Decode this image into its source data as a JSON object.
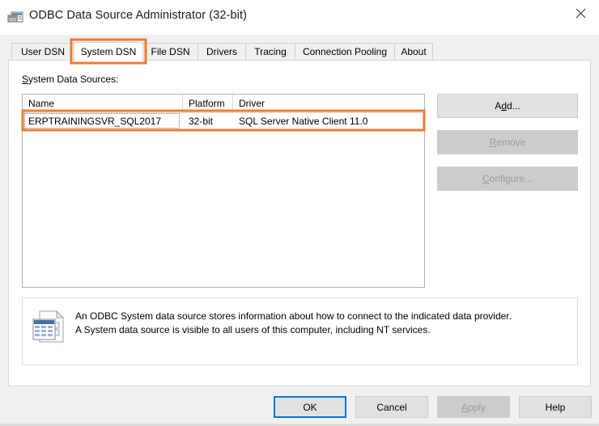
{
  "window": {
    "title": "ODBC Data Source Administrator (32-bit)",
    "icon": "odbc-administrator-icon",
    "close_label": "✕"
  },
  "tabs": [
    {
      "label": "User DSN",
      "selected": false
    },
    {
      "label": "System DSN",
      "selected": true
    },
    {
      "label": "File DSN",
      "selected": false
    },
    {
      "label": "Drivers",
      "selected": false
    },
    {
      "label": "Tracing",
      "selected": false
    },
    {
      "label": "Connection Pooling",
      "selected": false
    },
    {
      "label": "About",
      "selected": false
    }
  ],
  "list_caption": {
    "accel": "S",
    "rest": "ystem Data Sources:"
  },
  "list": {
    "columns": [
      {
        "label": "Name"
      },
      {
        "label": "Platform"
      },
      {
        "label": "Driver"
      }
    ],
    "rows": [
      {
        "name": "ERPTRAININGSVR_SQL2017",
        "platform": "32-bit",
        "driver": "SQL Server Native Client 11.0",
        "focused": true,
        "highlighted": true
      }
    ]
  },
  "side_buttons": [
    {
      "name": "add-button",
      "accel_pre": "A",
      "accel": "d",
      "accel_post": "d...",
      "label": "Add...",
      "enabled": true
    },
    {
      "name": "remove-button",
      "accel_pre": "",
      "accel": "R",
      "accel_post": "emove",
      "label": "Remove",
      "enabled": false
    },
    {
      "name": "configure-button",
      "accel_pre": "",
      "accel": "C",
      "accel_post": "onfigure...",
      "label": "Configure...",
      "enabled": false
    }
  ],
  "description": {
    "icon": "data-source-document-icon",
    "line1": "An ODBC System data source stores information about how to connect to the indicated data provider.",
    "line2": "A System data source is visible to all users of this computer, including NT services."
  },
  "footer_buttons": [
    {
      "name": "ok-button",
      "label": "OK",
      "enabled": true,
      "default": true
    },
    {
      "name": "cancel-button",
      "label": "Cancel",
      "enabled": true,
      "default": false
    },
    {
      "name": "apply-button",
      "label": "Apply",
      "accel": "A",
      "accel_post": "pply",
      "enabled": false,
      "default": false
    },
    {
      "name": "help-button",
      "label": "Help",
      "enabled": true,
      "default": false
    }
  ],
  "annotation": {
    "color": "#ED7D31",
    "targets": [
      "system-dsn-tab",
      "data-source-row"
    ]
  }
}
